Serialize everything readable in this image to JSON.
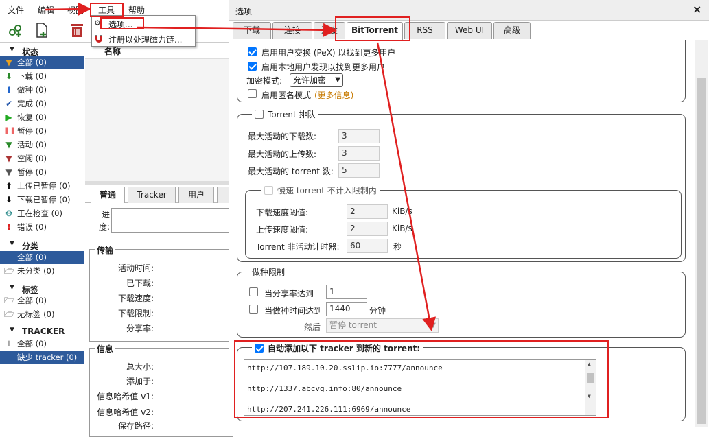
{
  "menubar": {
    "items": [
      "文件",
      "编辑",
      "视图",
      "工具",
      "帮助"
    ]
  },
  "toolbar": {
    "icons": [
      "add-torrent-link-icon",
      "add-torrent-file-icon",
      "delete-icon"
    ]
  },
  "dropdown": {
    "options_label": "选项...",
    "register_magnet_label": "注册以处理磁力链..."
  },
  "sidebar": {
    "status_title": "状态",
    "status_items": [
      {
        "label": "全部 (0)",
        "icon": "filter-icon",
        "color": "#e8a020"
      },
      {
        "label": "下载 (0)",
        "icon": "download-arrow-icon",
        "color": "#2a8a2a"
      },
      {
        "label": "做种 (0)",
        "icon": "upload-arrow-icon",
        "color": "#2266cc"
      },
      {
        "label": "完成 (0)",
        "icon": "check-icon",
        "color": "#2255aa"
      },
      {
        "label": "恢复 (0)",
        "icon": "play-icon",
        "color": "#22aa22"
      },
      {
        "label": "暂停 (0)",
        "icon": "pause-icon",
        "color": "#ee6666"
      },
      {
        "label": "活动 (0)",
        "icon": "filter-icon",
        "color": "#2a8a2a"
      },
      {
        "label": "空闲 (0)",
        "icon": "filter-icon",
        "color": "#aa3333"
      },
      {
        "label": "暂停 (0)",
        "icon": "filter-icon",
        "color": "#555555"
      },
      {
        "label": "上传已暂停 (0)",
        "icon": "upload-stalled-icon",
        "color": "#111111"
      },
      {
        "label": "下载已暂停 (0)",
        "icon": "download-stalled-icon",
        "color": "#111111"
      },
      {
        "label": "正在检查 (0)",
        "icon": "gear-icon",
        "color": "#2a8a8a"
      },
      {
        "label": "错误 (0)",
        "icon": "error-icon",
        "color": "#dd2222"
      }
    ],
    "category_title": "分类",
    "category_items": [
      "全部 (0)",
      "未分类 (0)"
    ],
    "tag_title": "标签",
    "tag_items": [
      "全部 (0)",
      "无标签 (0)"
    ],
    "tracker_title": "TRACKER",
    "tracker_items": [
      "全部 (0)",
      "缺少 tracker (0)"
    ]
  },
  "list": {
    "name_header": "名称"
  },
  "details": {
    "tabs": [
      "普通",
      "Tracker",
      "用户"
    ],
    "progress_label": "进度:",
    "transfer_title": "传输",
    "transfer_fields": [
      "活动时间:",
      "已下载:",
      "下载速度:",
      "下载限制:",
      "分享率:"
    ],
    "info_title": "信息",
    "info_fields": [
      "总大小:",
      "添加于:",
      "信息哈希值 v1:",
      "信息哈希值 v2:",
      "保存路径:"
    ]
  },
  "dialog": {
    "title": "选项",
    "close": "×",
    "tabs": [
      "下载",
      "连接",
      "速度",
      "BitTorrent",
      "RSS",
      "Web UI",
      "高级"
    ],
    "active_tab": "BitTorrent",
    "pex_label": "启用用户交换 (PeX) 以找到更多用户",
    "lsd_label": "启用本地用户发现以找到更多用户",
    "encryption_label": "加密模式:",
    "encryption_value": "允许加密",
    "anonymous_label": "启用匿名模式",
    "more_info_link": "(更多信息)",
    "queue": {
      "title": "Torrent 排队",
      "max_downloads_label": "最大活动的下载数:",
      "max_downloads": "3",
      "max_uploads_label": "最大活动的上传数:",
      "max_uploads": "3",
      "max_torrents_label": "最大活动的 torrent 数:",
      "max_torrents": "5",
      "slow": {
        "title": "慢速 torrent 不计入限制内",
        "dl_threshold_label": "下载速度阈值:",
        "dl_threshold": "2",
        "dl_unit": "KiB/s",
        "ul_threshold_label": "上传速度阈值:",
        "ul_threshold": "2",
        "ul_unit": "KiB/s",
        "timer_label": "Torrent 非活动计时器:",
        "timer": "60",
        "timer_unit": "秒"
      }
    },
    "seeding": {
      "title": "做种限制",
      "ratio_label": "当分享率达到",
      "ratio": "1",
      "time_label": "当做种时间达到",
      "time": "1440",
      "time_unit": "分钟",
      "then_label": "然后",
      "then_value": "暂停 torrent"
    },
    "trackers": {
      "title": "自动添加以下 tracker 到新的 torrent:",
      "lines": [
        "http://107.189.10.20.sslip.io:7777/announce",
        "",
        "http://1337.abcvg.info:80/announce",
        "",
        "http://207.241.226.111:6969/announce"
      ]
    }
  },
  "colors": {
    "selection": "#2d5a9b",
    "annotation": "#e02020",
    "checkbox": "#0075ff"
  }
}
